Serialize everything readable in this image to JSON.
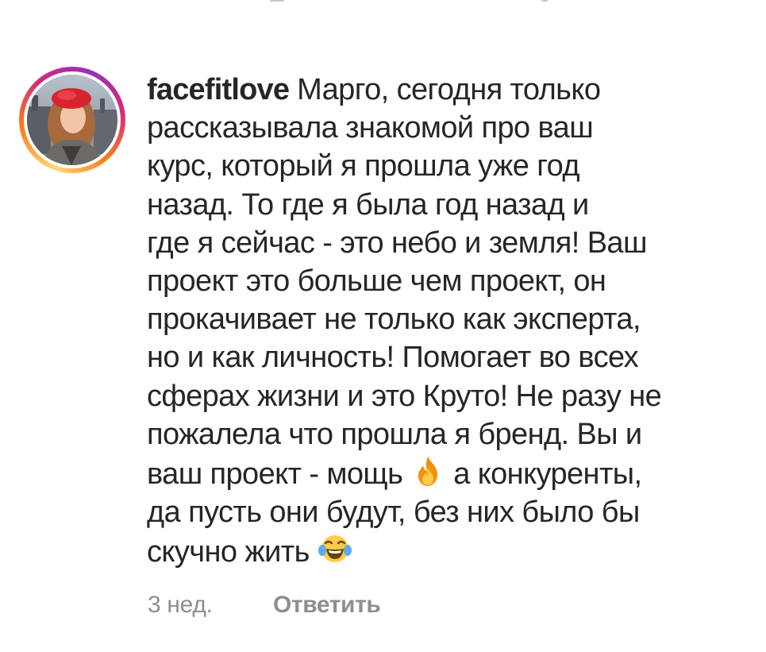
{
  "comment": {
    "username": "facefitlove",
    "lines": [
      "Марго, сегодня только",
      "рассказывала знакомой про ваш",
      "курс, который я прошла уже год",
      "назад. То где я была год назад и",
      "где я сейчас - это небо и земля! Ваш",
      "проект это больше чем проект, он",
      "прокачивает не только как эксперта,",
      "но и как личность! Помогает во всех",
      "сферах жизни и это Круто! Не разу не",
      "пожалела что прошла я бренд. Вы и"
    ],
    "line_fire_before": "ваш проект - мощь",
    "line_fire_after": "а конкуренты,",
    "line_12": "да пусть они будут, без них было бы",
    "line_last": "скучно жить",
    "emoji_icons": [
      "fire-emoji-icon",
      "laughing-tears-emoji-icon"
    ],
    "time_ago": "3 нед.",
    "reply_label": "Ответить"
  },
  "colors": {
    "text": "#262626",
    "meta": "#8e8e8e",
    "story_ring": [
      "#feda75",
      "#fa7e1e",
      "#d62976",
      "#962fbf"
    ]
  }
}
